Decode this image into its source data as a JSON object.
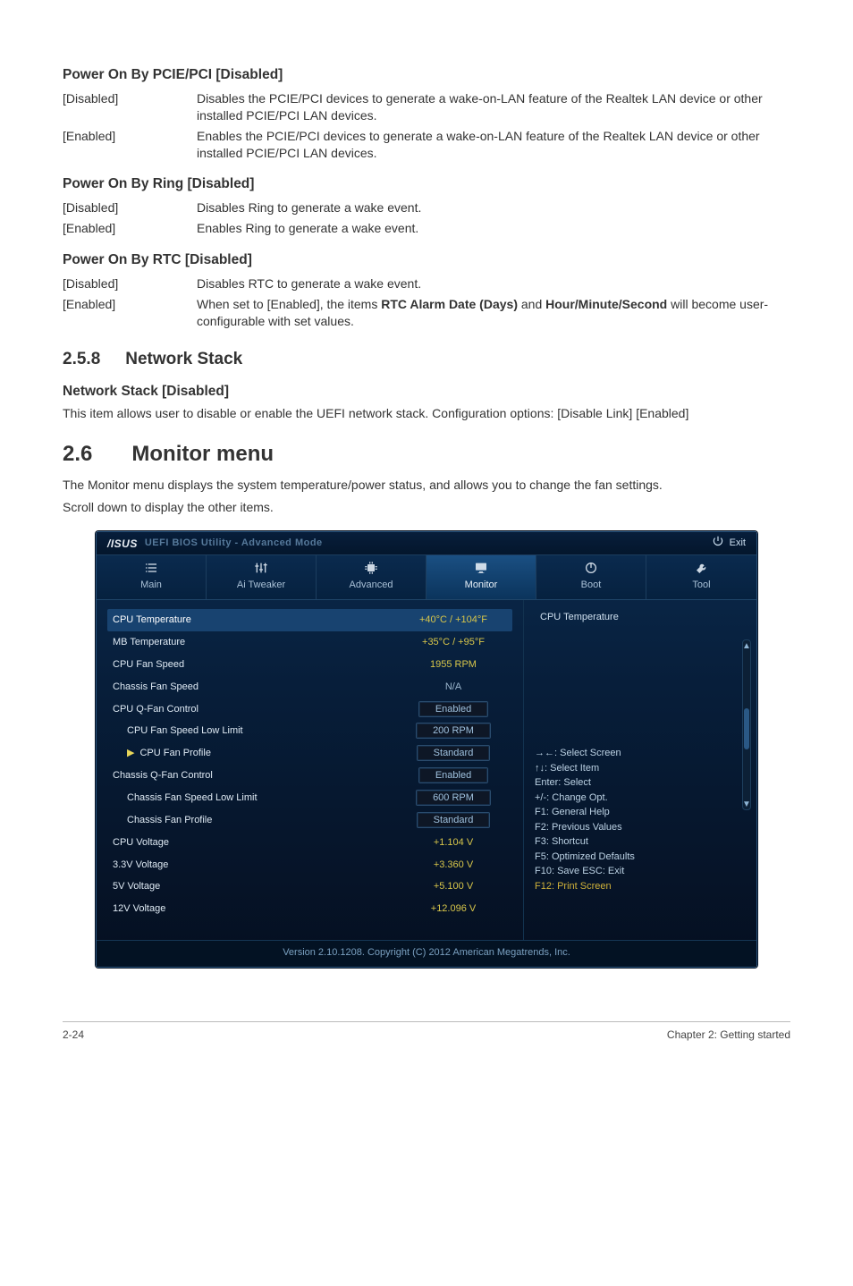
{
  "sections": {
    "s1": {
      "title": "Power On By PCIE/PCI [Disabled]",
      "rows": [
        {
          "k": "[Disabled]",
          "v": "Disables the PCIE/PCI devices to generate a wake-on-LAN feature of the Realtek LAN device or other installed PCIE/PCI LAN devices."
        },
        {
          "k": "[Enabled]",
          "v": "Enables the PCIE/PCI devices to generate a wake-on-LAN feature of the Realtek LAN device or other installed PCIE/PCI LAN devices."
        }
      ]
    },
    "s2": {
      "title": "Power On By Ring [Disabled]",
      "rows": [
        {
          "k": "[Disabled]",
          "v": "Disables Ring to generate a wake event."
        },
        {
          "k": "[Enabled]",
          "v": "Enables Ring to generate a wake event."
        }
      ]
    },
    "s3": {
      "title": "Power On By RTC [Disabled]",
      "rows": [
        {
          "k": "[Disabled]",
          "v": "Disables RTC to generate a wake event."
        }
      ],
      "enabled_prefix": "[Enabled]",
      "enabled_pre": "When set to [Enabled], the items ",
      "enabled_bold1": "RTC Alarm Date (Days)",
      "enabled_mid": " and ",
      "enabled_bold2": "Hour/Minute/Second",
      "enabled_post": " will become user-configurable with set values."
    },
    "h3": {
      "num": "2.5.8",
      "txt": "Network Stack"
    },
    "s4": {
      "title": "Network Stack [Disabled]",
      "desc": "This item allows user to disable or enable the UEFI network stack. Configuration options: [Disable Link] [Enabled]"
    },
    "h2": {
      "num": "2.6",
      "txt": "Monitor menu"
    },
    "mon_desc1": "The Monitor menu displays the system temperature/power status, and allows you to change the fan settings.",
    "mon_desc2": "Scroll down to display the other items."
  },
  "bios": {
    "brand": "/ISUS",
    "titlebar": "UEFI BIOS Utility - Advanced Mode",
    "exit": "Exit",
    "tabs": [
      "Main",
      "Ai Tweaker",
      "Advanced",
      "Monitor",
      "Boot",
      "Tool"
    ],
    "active_tab": 3,
    "rows": [
      {
        "label": "CPU Temperature",
        "value": "+40°C / +104°F",
        "type": "yellow",
        "hi": true
      },
      {
        "label": "MB Temperature",
        "value": "+35°C / +95°F",
        "type": "yellow"
      },
      {
        "label": "CPU Fan Speed",
        "value": "1955 RPM",
        "type": "yellow"
      },
      {
        "label": "Chassis Fan Speed",
        "value": "N/A",
        "type": "na"
      },
      {
        "label": "CPU Q-Fan Control",
        "value": "Enabled",
        "type": "box"
      },
      {
        "label": "CPU Fan Speed Low Limit",
        "value": "200 RPM",
        "type": "box",
        "sub": true
      },
      {
        "label": "CPU Fan Profile",
        "value": "Standard",
        "type": "box",
        "sub": true,
        "arrow": true
      },
      {
        "label": "Chassis Q-Fan Control",
        "value": "Enabled",
        "type": "box"
      },
      {
        "label": "Chassis Fan Speed Low Limit",
        "value": "600 RPM",
        "type": "box",
        "sub": true
      },
      {
        "label": "Chassis Fan Profile",
        "value": "Standard",
        "type": "box",
        "sub": true
      },
      {
        "label": "CPU Voltage",
        "value": "+1.104 V",
        "type": "yellow"
      },
      {
        "label": "3.3V Voltage",
        "value": "+3.360 V",
        "type": "yellow"
      },
      {
        "label": "5V Voltage",
        "value": "+5.100 V",
        "type": "yellow"
      },
      {
        "label": "12V Voltage",
        "value": "+12.096 V",
        "type": "yellow"
      }
    ],
    "hint_right": "CPU Temperature",
    "quick": {
      "q1": "→←: Select Screen",
      "q2": "↑↓: Select Item",
      "q3": "Enter: Select",
      "q4": "+/-: Change Opt.",
      "q5": "F1: General Help",
      "q6": "F2: Previous Values",
      "q7": "F3: Shortcut",
      "q8": "F5: Optimized Defaults",
      "q9": "F10: Save  ESC: Exit",
      "q10": "F12: Print Screen"
    },
    "footer": "Version 2.10.1208. Copyright (C) 2012 American Megatrends, Inc."
  },
  "page_footer": {
    "left": "2-24",
    "right": "Chapter 2: Getting started"
  }
}
